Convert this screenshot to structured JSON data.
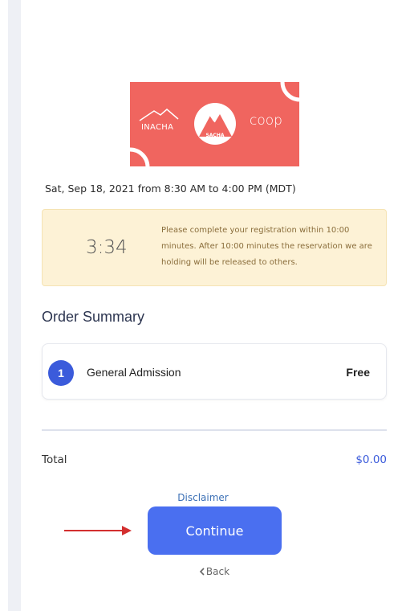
{
  "banner": {
    "left_logo_text": "INACHA",
    "center_logo_text": "SACHA",
    "right_logo_text": "coop",
    "color": "#f0655f"
  },
  "event": {
    "date_text": "Sat, Sep 18, 2021 from 8:30 AM to 4:00 PM (MDT)"
  },
  "timer": {
    "value": "3:34",
    "message": "Please complete your registration within 10:00 minutes. After 10:00 minutes the reservation we are holding will be released to others."
  },
  "order_summary": {
    "title": "Order Summary",
    "items": [
      {
        "number": "1",
        "name": "General Admission",
        "price": "Free"
      }
    ]
  },
  "total": {
    "label": "Total",
    "value": "$0.00"
  },
  "actions": {
    "disclaimer_label": "Disclaimer",
    "continue_label": "Continue",
    "back_label": "Back",
    "back_icon": "chevron-left-icon"
  },
  "colors": {
    "accent": "#4a6ff0",
    "timer_bg": "#fdf2d6",
    "arrow": "#d32f2f"
  }
}
